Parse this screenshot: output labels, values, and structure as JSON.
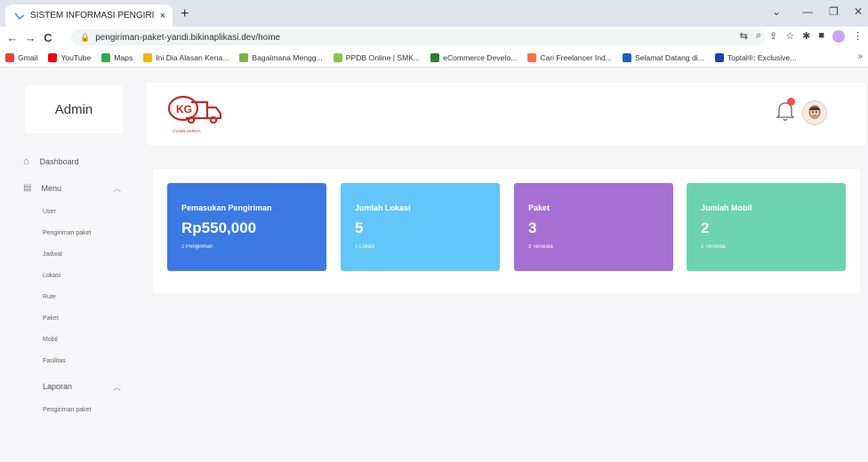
{
  "browser": {
    "tab_title": "SISTEM INFORMASI PENGIRIMAN",
    "tab_close": "×",
    "new_tab": "+",
    "url": "pengiriman-paket-yandi.bikinaplikasi.dev/home",
    "back": "←",
    "forward": "→",
    "reload": "C",
    "lock": "🔒",
    "minimize": "—",
    "restore": "❐",
    "close": "✕",
    "dropdown": "⌄",
    "bookmarks": [
      {
        "label": "Gmail",
        "color": "#ea4335"
      },
      {
        "label": "YouTube",
        "color": "#ff0000"
      },
      {
        "label": "Maps",
        "color": "#34a853"
      },
      {
        "label": "Ini Dia Alasan Kena...",
        "color": "#f4b400"
      },
      {
        "label": "Bagaimana Mengg...",
        "color": "#7cb342"
      },
      {
        "label": "PPDB Online | SMK...",
        "color": "#8bc34a"
      },
      {
        "label": "eCommerce Develo...",
        "color": "#2e7d32"
      },
      {
        "label": "Cari Freelancer Ind...",
        "color": "#ff7043"
      },
      {
        "label": "Selamat Datang di...",
        "color": "#1565c0"
      },
      {
        "label": "Toptal®: Exclusive...",
        "color": "#1e40af"
      }
    ],
    "bookmarks_more": "»"
  },
  "sidebar": {
    "admin_label": "Admin",
    "dashboard_label": "Dashboard",
    "menu_label": "Menu",
    "menu_items": [
      "User",
      "Pengiriman paket",
      "Jadwal",
      "Lokasi",
      "Rute",
      "Paket",
      "Mobil",
      "Fasilitas"
    ],
    "report_label": "Laporan",
    "report_items": [
      "Pengiriman paket"
    ],
    "chevron": "︿"
  },
  "header": {
    "logo_text": "KG",
    "logo_caption": "CV.KELUARGA"
  },
  "stats": [
    {
      "label": "Pemasukan Pengiriman",
      "value": "Rp550,000",
      "sub": "2 Pengiriman",
      "color": "#3b7ae4"
    },
    {
      "label": "Jumlah Lokasi",
      "value": "5",
      "sub": "5 Lokasi",
      "color": "#62c6fa"
    },
    {
      "label": "Paket",
      "value": "3",
      "sub": "3 Tersedia",
      "color": "#a56fd4"
    },
    {
      "label": "Jumlah Mobil",
      "value": "2",
      "sub": "2 Tersedia",
      "color": "#6bd3b0"
    }
  ]
}
